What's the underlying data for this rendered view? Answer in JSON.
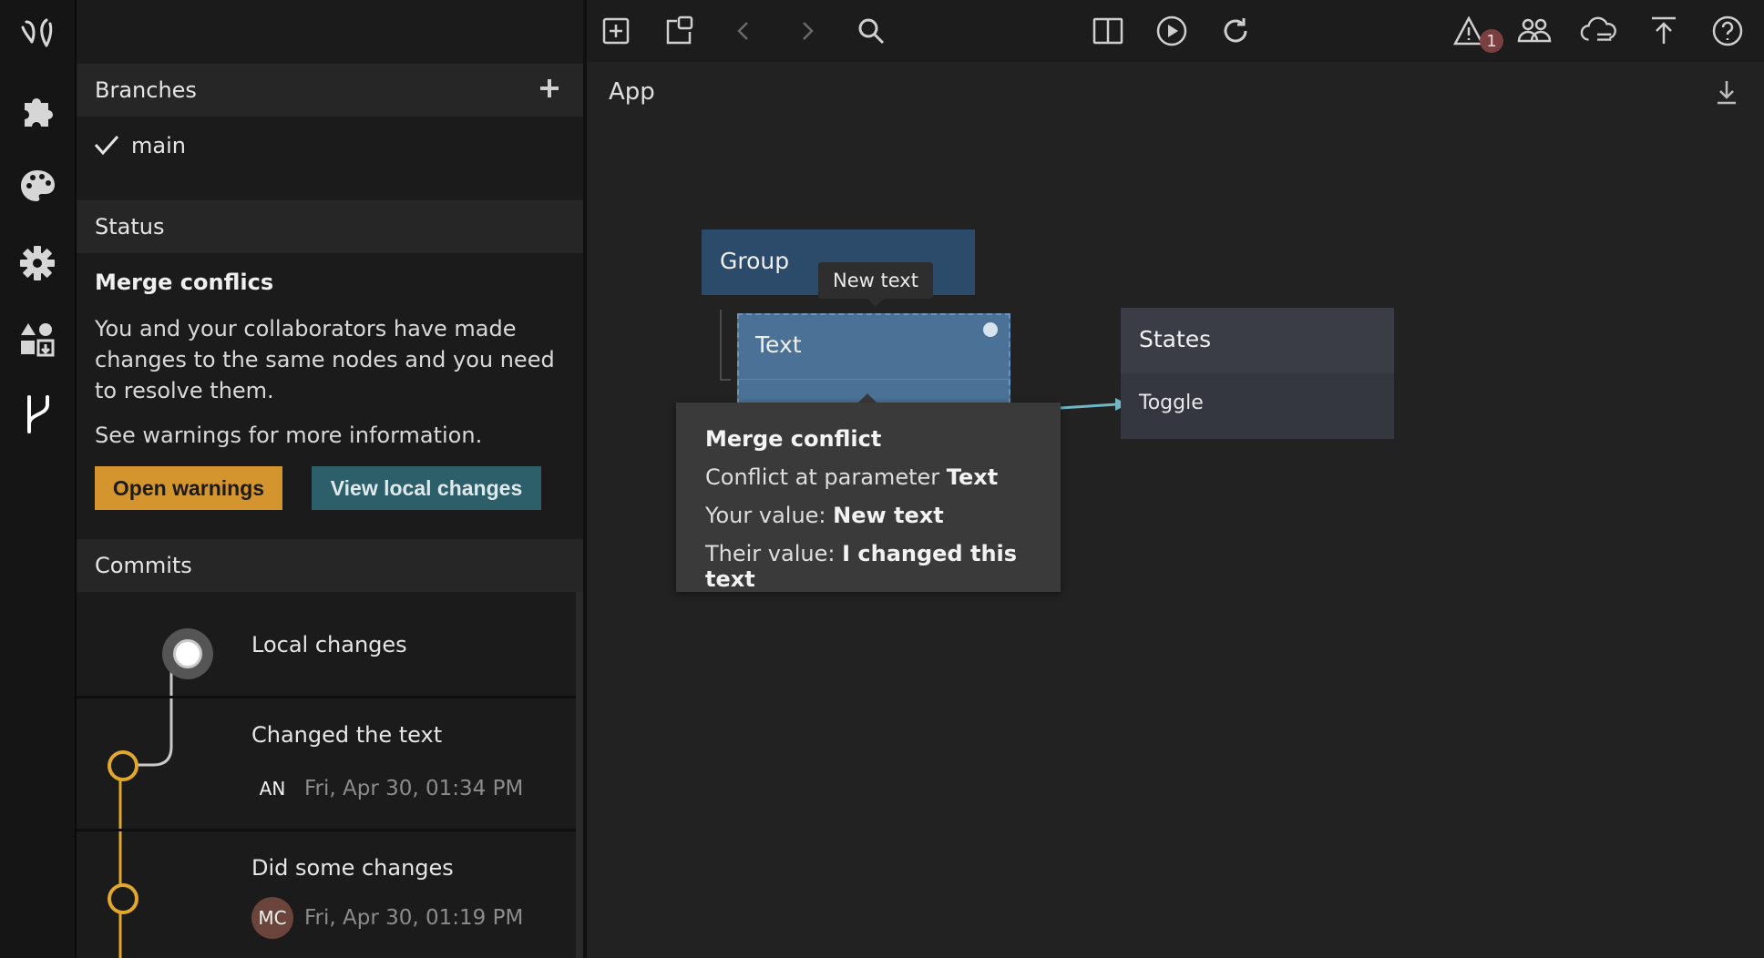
{
  "panel": {
    "branches": {
      "title": "Branches",
      "items": [
        {
          "label": "main",
          "selected": true
        }
      ]
    },
    "status": {
      "title": "Status",
      "heading": "Merge conflics",
      "description": "You and your collaborators have made changes to the same nodes and you need to resolve them.",
      "hint": "See warnings for more information.",
      "open_warnings_label": "Open warnings",
      "view_local_changes_label": "View local changes"
    },
    "commits": {
      "title": "Commits",
      "items": [
        {
          "title": "Local changes"
        },
        {
          "title": "Changed the text",
          "author": "AN",
          "date": "Fri, Apr 30, 01:34 PM"
        },
        {
          "title": "Did some changes",
          "author": "MC",
          "date": "Fri, Apr 30, 01:19 PM"
        }
      ]
    }
  },
  "toolbar": {
    "warning_count": "1"
  },
  "canvas": {
    "title": "App",
    "nodes": {
      "group": "Group",
      "text": "Text",
      "states": {
        "title": "States",
        "port": "Toggle"
      }
    },
    "text_tooltip": "New text",
    "merge_tooltip": {
      "title": "Merge conflict",
      "param_prefix": "Conflict at parameter",
      "param": "Text",
      "yours_prefix": "Your value:",
      "yours": "New text",
      "theirs_prefix": "Their value:",
      "theirs": "I changed this text"
    }
  },
  "colors": {
    "accent_orange": "#d5952e",
    "accent_teal": "#2d5f6a",
    "node_blue": "#2c4b6b",
    "node_selected": "#4b7296",
    "states_node": "#343740",
    "connection": "#6fb5c3",
    "commit_line": "#e2a82d"
  },
  "icons": {
    "rail": [
      "app-logo-icon",
      "puzzle-icon",
      "palette-icon",
      "gear-icon",
      "components-icon",
      "branch-icon"
    ],
    "toolbar": [
      "add-node-icon",
      "clipboard-icon",
      "chevron-left-icon",
      "chevron-right-icon",
      "search-icon",
      "split-view-icon",
      "play-icon",
      "refresh-icon",
      "warning-icon",
      "users-icon",
      "cloud-icon",
      "upload-icon",
      "help-icon"
    ]
  }
}
